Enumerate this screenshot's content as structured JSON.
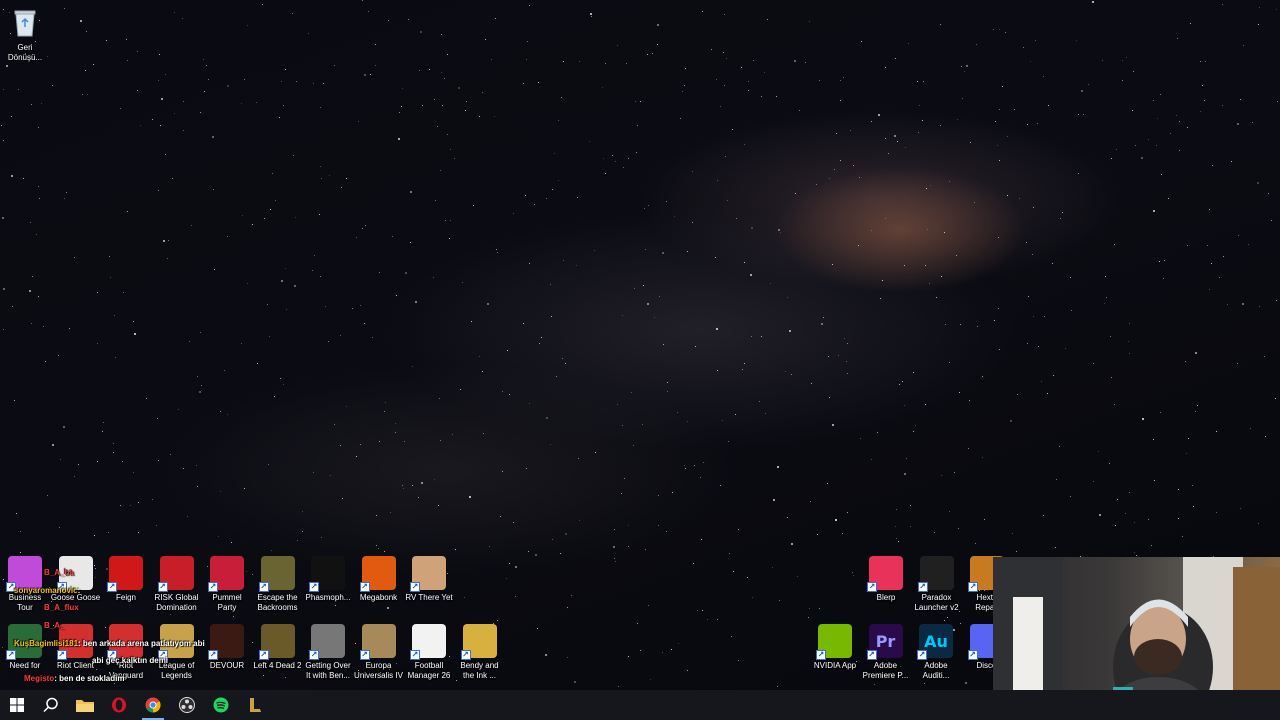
{
  "desktop": {
    "top_left_icon": {
      "label": "Geri\nDönüşü...",
      "icon": "recycle-bin-icon"
    },
    "row1": [
      {
        "label": "Business Tour",
        "icon": "business-tour-icon",
        "color": "#c04bd8"
      },
      {
        "label": "Goose Goose",
        "icon": "goose-icon",
        "color": "#e8e8e8"
      },
      {
        "label": "Feign",
        "icon": "feign-icon",
        "color": "#d01818"
      },
      {
        "label": "RISK Global\nDomination",
        "icon": "risk-icon",
        "color": "#c81e2a"
      },
      {
        "label": "Pummel\nParty",
        "icon": "pummel-party-icon",
        "color": "#c81e3a"
      },
      {
        "label": "Escape the\nBackrooms",
        "icon": "escape-backrooms-icon",
        "color": "#6a6433"
      },
      {
        "label": "Phasmoph...",
        "icon": "phasmophobia-icon",
        "color": "#111111"
      },
      {
        "label": "Megabonk",
        "icon": "megabonk-icon",
        "color": "#e05a10"
      },
      {
        "label": "RV There Yet",
        "icon": "rv-there-yet-icon",
        "color": "#cfa27a"
      }
    ],
    "row2": [
      {
        "label": "Need for",
        "icon": "need-for-speed-icon",
        "color": "#2a6b3a"
      },
      {
        "label": "Riot Client",
        "icon": "riot-client-icon",
        "color": "#d32f2f"
      },
      {
        "label": "Riot Vanguard",
        "icon": "riot-vanguard-icon",
        "color": "#d32f2f"
      },
      {
        "label": "League of\nLegends",
        "icon": "league-icon",
        "color": "#c8a24a"
      },
      {
        "label": "DEVOUR",
        "icon": "devour-icon",
        "color": "#3a1a12"
      },
      {
        "label": "Left 4 Dead 2",
        "icon": "left4dead2-icon",
        "color": "#6a5a2a"
      },
      {
        "label": "Getting Over\nIt with Ben...",
        "icon": "getting-over-it-icon",
        "color": "#777777"
      },
      {
        "label": "Europa\nUniversalis IV",
        "icon": "europa-icon",
        "color": "#a88a5a"
      },
      {
        "label": "Football\nManager 26",
        "icon": "football-manager-icon",
        "color": "#f2f2f2"
      },
      {
        "label": "Bendy and\nthe Ink ...",
        "icon": "bendy-icon",
        "color": "#d8b040"
      }
    ],
    "right_row1": [
      {
        "label": "Blerp",
        "icon": "blerp-icon",
        "color": "#e8325a"
      },
      {
        "label": "Paradox\nLauncher v2",
        "icon": "paradox-icon",
        "color": "#202020"
      },
      {
        "label": "Hexte\nRepair",
        "icon": "hextech-icon",
        "color": "#c87a20"
      }
    ],
    "right_row2": [
      {
        "label": "NVIDIA App",
        "icon": "nvidia-icon",
        "color": "#76b900",
        "text": ""
      },
      {
        "label": "Adobe\nPremiere P...",
        "icon": "premiere-icon",
        "color": "#2a0a4a",
        "text": "Pr"
      },
      {
        "label": "Adobe\nAuditi...",
        "icon": "audition-icon",
        "color": "#0a2a44",
        "text": "Au"
      },
      {
        "label": "Disco",
        "icon": "discord-icon",
        "color": "#5865f2",
        "text": ""
      }
    ]
  },
  "chat": {
    "messages": [
      {
        "user": "B_A_ba",
        "text": "",
        "user_color": "red"
      },
      {
        "user": "sonyaromanovic",
        "text": ":",
        "user_color": "yellow"
      },
      {
        "user": "B_A_flux",
        "text": "",
        "user_color": "red"
      },
      {
        "user": "B_A_",
        "text": "",
        "user_color": "red"
      },
      {
        "user": "KuşBagimlisi181",
        "text": ": ben arkada arena patlatıyom abi",
        "user_color": "yellow"
      },
      {
        "user": "",
        "text": "abi geç kalktın demi",
        "user_color": "red"
      },
      {
        "user": "Megisto",
        "text": ": ben de stokladım",
        "user_color": "red"
      }
    ]
  },
  "taskbar": {
    "items": [
      {
        "name": "start-button",
        "icon": "windows-icon"
      },
      {
        "name": "search-button",
        "icon": "search-icon"
      },
      {
        "name": "file-explorer",
        "icon": "folder-icon"
      },
      {
        "name": "opera-gx",
        "icon": "opera-icon"
      },
      {
        "name": "chrome",
        "icon": "chrome-icon"
      },
      {
        "name": "obs",
        "icon": "obs-icon"
      },
      {
        "name": "spotify",
        "icon": "spotify-icon"
      },
      {
        "name": "league-client",
        "icon": "league-icon"
      }
    ]
  }
}
